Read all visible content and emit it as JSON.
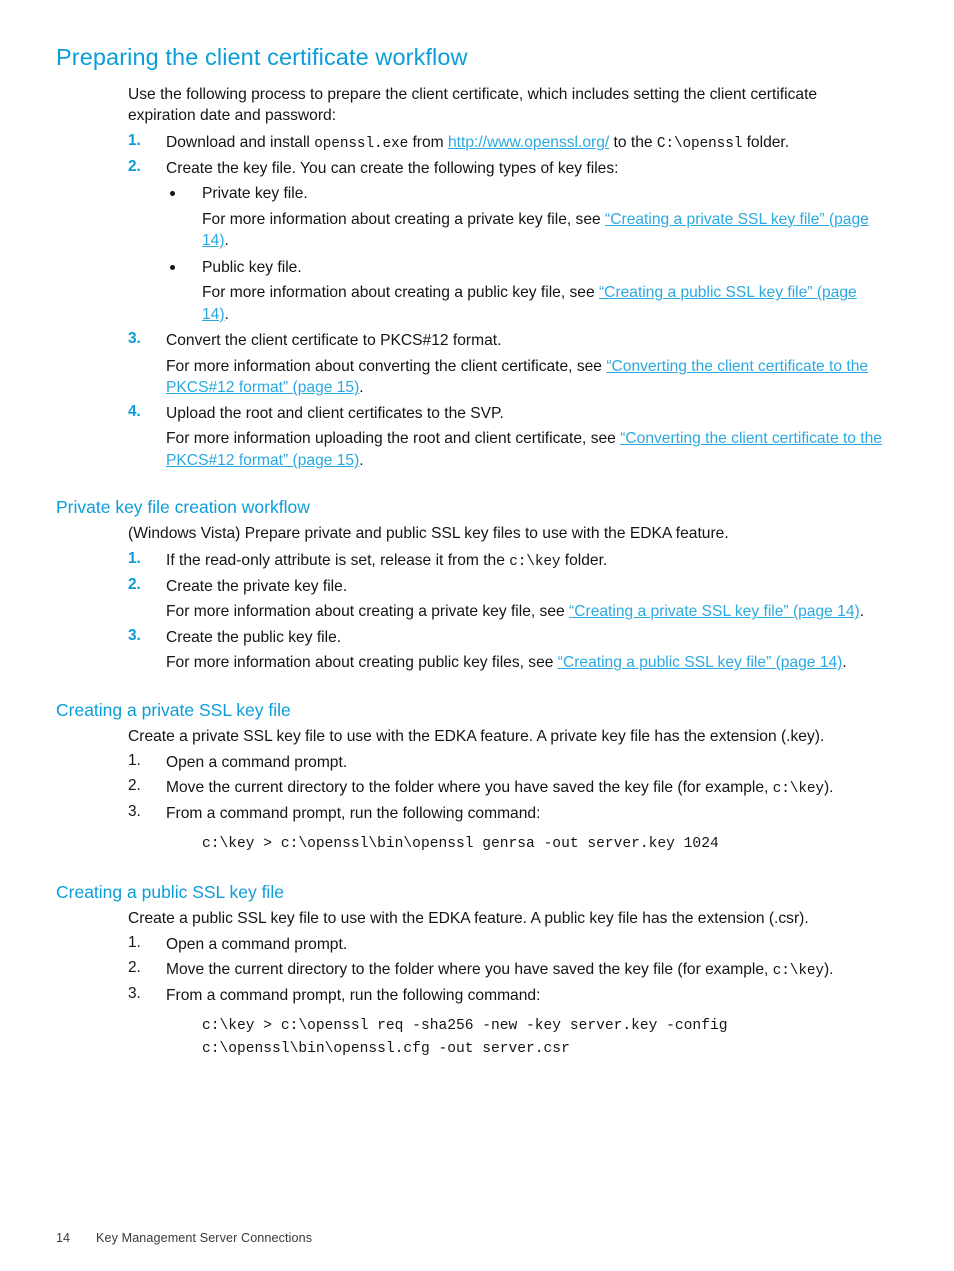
{
  "page": {
    "footer_page_number": "14",
    "footer_title": "Key Management Server Connections",
    "accent_heading_color": "#0b9dd9",
    "accent_link_color": "#2aa9e0",
    "body_text_color": "#141414"
  },
  "section1": {
    "heading": "Preparing the client certificate workflow",
    "intro": "Use the following process to prepare the client certificate, which includes setting the client certificate expiration date and password:",
    "steps": [
      {
        "num": "1.",
        "text_a": "Download and install ",
        "code_a": "openssl.exe",
        "text_b": " from ",
        "link": "http://www.openssl.org/",
        "text_c": " to the ",
        "code_b": "C:\\openssl",
        "text_d": " folder."
      },
      {
        "num": "2.",
        "text_a": "Create the key file. You can create the following types of key files:",
        "bullets": [
          {
            "label": "Private key file.",
            "detail_a": "For more information about creating a private key file, see ",
            "detail_xref": "“Creating a private SSL key file” (page 14)",
            "detail_b": "."
          },
          {
            "label": "Public key file.",
            "detail_a": "For more information about creating a public key file, see ",
            "detail_xref": "“Creating a public SSL key file” (page 14)",
            "detail_b": "."
          }
        ]
      },
      {
        "num": "3.",
        "text_a": "Convert the client certificate to PKCS#12 format.",
        "detail_a": "For more information about converting the client certificate, see ",
        "detail_xref": "“Converting the client certificate to the PKCS#12 format” (page 15)",
        "detail_b": "."
      },
      {
        "num": "4.",
        "text_a": "Upload the root and client certificates to the SVP.",
        "detail_a": "For more information uploading the root and client certificate, see ",
        "detail_xref": "“Converting the client certificate to the PKCS#12 format” (page 15)",
        "detail_b": "."
      }
    ]
  },
  "section2": {
    "heading": "Private key file creation workflow",
    "intro": "(Windows Vista) Prepare private and public SSL key files to use with the EDKA feature.",
    "steps": [
      {
        "num": "1.",
        "text_a": "If the read-only attribute is set, release it from the ",
        "code_a": "c:\\key",
        "text_b": " folder."
      },
      {
        "num": "2.",
        "text_a": "Create the private key file.",
        "detail_a": "For more information about creating a private key file, see ",
        "detail_xref": "“Creating a private SSL key file” (page 14)",
        "detail_b": "."
      },
      {
        "num": "3.",
        "text_a": "Create the public key file.",
        "detail_a": "For more information about creating public key files, see ",
        "detail_xref": "“Creating a public SSL key file” (page 14)",
        "detail_b": "."
      }
    ]
  },
  "section3": {
    "heading": "Creating a private SSL key file",
    "intro": "Create a private SSL key file to use with the EDKA feature. A private key file has the extension (.key).",
    "steps": [
      {
        "num": "1.",
        "text_a": "Open a command prompt."
      },
      {
        "num": "2.",
        "text_a": "Move the current directory to the folder where you have saved the key file (for example, ",
        "code_a": "c:\\key",
        "text_b": ")."
      },
      {
        "num": "3.",
        "text_a": "From a command prompt, run the following command:"
      }
    ],
    "command": "c:\\key > c:\\openssl\\bin\\openssl genrsa -out server.key 1024"
  },
  "section4": {
    "heading": "Creating a public SSL key file",
    "intro": "Create a public SSL key file to use with the EDKA feature. A public key file has the extension (.csr).",
    "steps": [
      {
        "num": "1.",
        "text_a": "Open a command prompt."
      },
      {
        "num": "2.",
        "text_a": "Move the current directory to the folder where you have saved the key file (for example, ",
        "code_a": "c:\\key",
        "text_b": ")."
      },
      {
        "num": "3.",
        "text_a": "From a command prompt, run the following command:"
      }
    ],
    "command": "c:\\key > c:\\openssl req -sha256 -new -key server.key -config\nc:\\openssl\\bin\\openssl.cfg -out server.csr"
  }
}
